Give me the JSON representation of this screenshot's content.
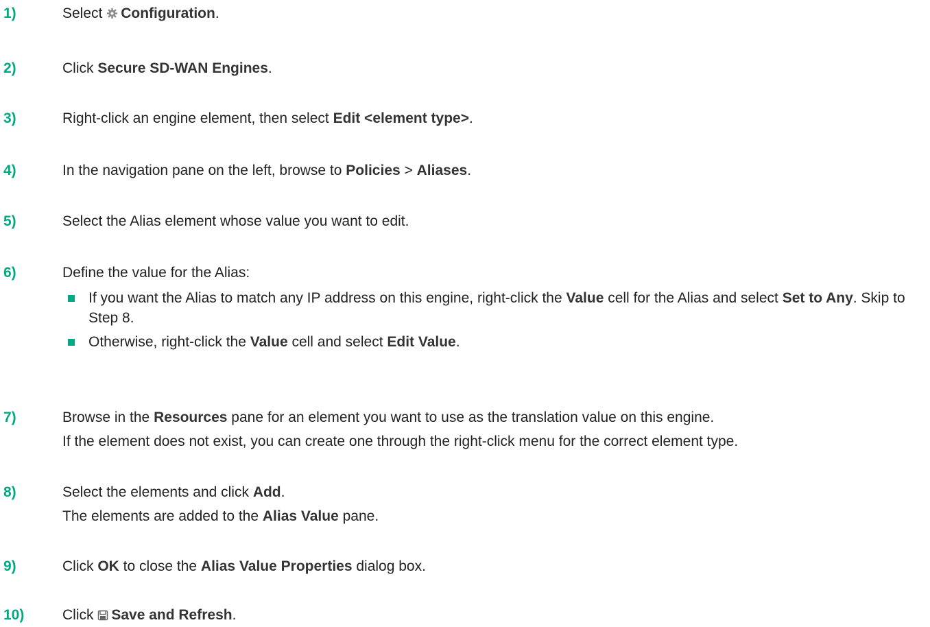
{
  "steps": [
    {
      "num": "1)",
      "pre": "Select ",
      "b1": "Configuration",
      "post": ".",
      "icon": "gear-icon"
    },
    {
      "num": "2)",
      "pre": "Click ",
      "b1": "Secure SD-WAN Engines",
      "post": "."
    },
    {
      "num": "3)",
      "pre": "Right-click an engine element, then select ",
      "b1": "Edit <element type>",
      "post": "."
    },
    {
      "num": "4)",
      "pre": "In the navigation pane on the left, browse to ",
      "b1": "Policies",
      "mid": " > ",
      "b2": "Aliases",
      "post": "."
    },
    {
      "num": "5)",
      "text": "Select the Alias element whose value you want to edit."
    },
    {
      "num": "6)",
      "text": "Define the value for the Alias:",
      "bullets": [
        {
          "pre": "If you want the Alias to match any IP address on this engine, right-click the ",
          "b1": "Value",
          "mid": " cell for the Alias and select ",
          "b2": "Set to Any",
          "post": ". Skip to Step 8."
        },
        {
          "pre": "Otherwise, right-click the ",
          "b1": "Value",
          "mid": " cell and select ",
          "b2": "Edit Value",
          "post": "."
        }
      ]
    },
    {
      "num": "7)",
      "pre": "Browse in the ",
      "b1": "Resources",
      "post": " pane for an element you want to use as the translation value on this engine.",
      "cont": "If the element does not exist, you can create one through the right-click menu for the correct element type."
    },
    {
      "num": "8)",
      "pre": "Select the elements and click ",
      "b1": "Add",
      "post": ".",
      "cont_pre": "The elements are added to the ",
      "cont_b": "Alias Value",
      "cont_post": " pane."
    },
    {
      "num": "9)",
      "pre": "Click ",
      "b1": "OK",
      "mid": " to close the ",
      "b2": "Alias Value Properties",
      "post": " dialog box."
    },
    {
      "num": "10)",
      "pre": "Click ",
      "b1": "Save and Refresh",
      "post": ".",
      "icon": "save-icon"
    }
  ],
  "colors": {
    "accent": "#01a982",
    "text": "#222222",
    "icon": "#8a8a8a"
  }
}
